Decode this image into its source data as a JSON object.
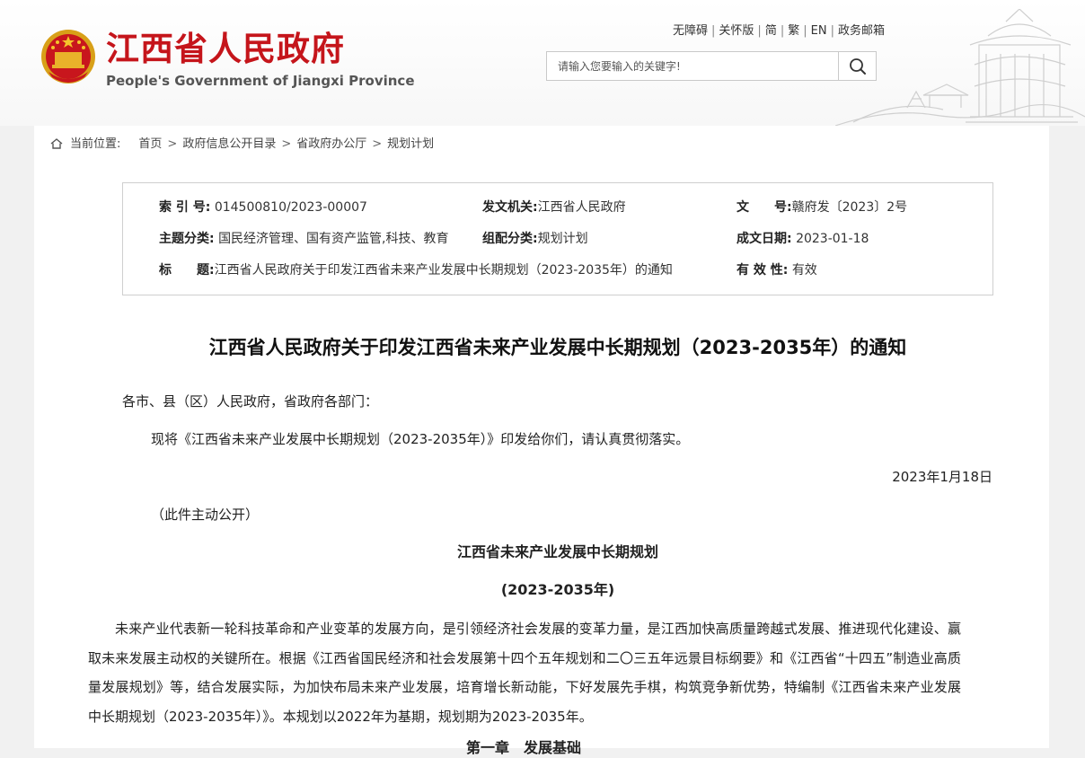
{
  "header": {
    "title": "江西省人民政府",
    "subtitle": "People's Government of Jiangxi Province",
    "links": [
      "无障碍",
      "关怀版",
      "简",
      "繁",
      "EN",
      "政务邮箱"
    ],
    "search_placeholder": "请输入您要输入的关键字!",
    "brand_red": "#c5151b"
  },
  "breadcrumb": {
    "label": "当前位置:",
    "items": [
      "首页",
      "政府信息公开目录",
      "省政府办公厅",
      "规划计划"
    ]
  },
  "meta": {
    "index_label": "索 引 号:",
    "index_value": "014500810/2023-00007",
    "issuer_label": "发文机关:",
    "issuer_value": "江西省人民政府",
    "docno_label": "文　　号:",
    "docno_value": "赣府发〔2023〕2号",
    "topic_label": "主题分类:",
    "topic_value": "国民经济管理、国有资产监管,科技、教育",
    "group_label": "组配分类:",
    "group_value": "规划计划",
    "date_label": "成文日期:",
    "date_value": "2023-01-18",
    "title_label": "标　　题:",
    "title_value": "江西省人民政府关于印发江西省未来产业发展中长期规划（2023-2035年）的通知",
    "valid_label": "有 效 性:",
    "valid_value": "有效"
  },
  "article": {
    "title": "江西省人民政府关于印发江西省未来产业发展中长期规划（2023-2035年）的通知",
    "salutation": "各市、县（区）人民政府，省政府各部门：",
    "notice": "现将《江西省未来产业发展中长期规划（2023-2035年）》印发给你们，请认真贯彻落实。",
    "date": "2023年1月18日",
    "public_note": "（此件主动公开）",
    "plan_title": "江西省未来产业发展中长期规划",
    "plan_period": "(2023-2035年)",
    "body": "未来产业代表新一轮科技革命和产业变革的发展方向，是引领经济社会发展的变革力量，是江西加快高质量跨越式发展、推进现代化建设、赢取未来发展主动权的关键所在。根据《江西省国民经济和社会发展第十四个五年规划和二〇三五年远景目标纲要》和《江西省“十四五”制造业高质量发展规划》等，结合发展实际，为加快布局未来产业发展，培育增长新动能，下好发展先手棋，构筑竞争新优势，特编制《江西省未来产业发展中长期规划（2023-2035年）》。本规划以2022年为基期，规划期为2023-2035年。",
    "section_heading": "第一章　发展基础"
  }
}
